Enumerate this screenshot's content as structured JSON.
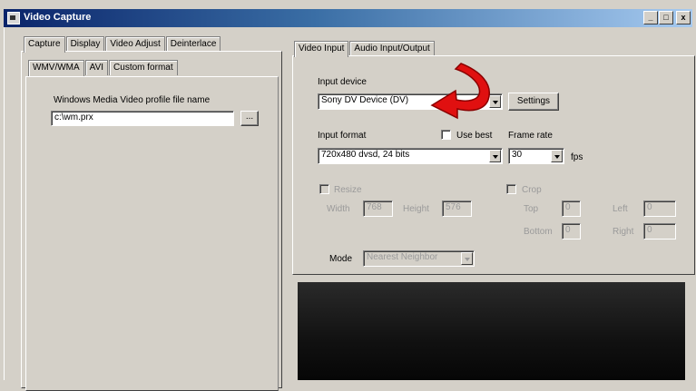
{
  "window": {
    "title": "Video Capture",
    "buttons": [
      "_",
      "□",
      "x"
    ]
  },
  "main_tabs": [
    "Capture",
    "Display",
    "Video Adjust",
    "Deinterlace"
  ],
  "format_tabs": [
    "WMV/WMA",
    "AVI",
    "Custom format"
  ],
  "wmv": {
    "profile_label": "Windows Media Video profile file name",
    "profile_value": "c:\\wm.prx",
    "browse_label": "..."
  },
  "input_tabs": [
    "Video Input",
    "Audio Input/Output"
  ],
  "video_input": {
    "device_label": "Input device",
    "device_value": "Sony DV Device (DV)",
    "settings_label": "Settings",
    "format_label": "Input format",
    "use_best_label": "Use best",
    "frame_rate_label": "Frame rate",
    "format_value": "720x480 dvsd, 24 bits",
    "frame_rate_value": "30",
    "fps_label": "fps",
    "resize_label": "Resize",
    "width_label": "Width",
    "width_value": "768",
    "height_label": "Height",
    "height_value": "576",
    "crop_label": "Crop",
    "top_label": "Top",
    "top_value": "0",
    "left_label": "Left",
    "left_value": "0",
    "bottom_label": "Bottom",
    "bottom_value": "0",
    "right_label": "Right",
    "right_value": "0",
    "mode_label": "Mode",
    "mode_value": "Nearest Neighbor"
  },
  "annotation": {
    "arrow_color": "#e01010"
  }
}
